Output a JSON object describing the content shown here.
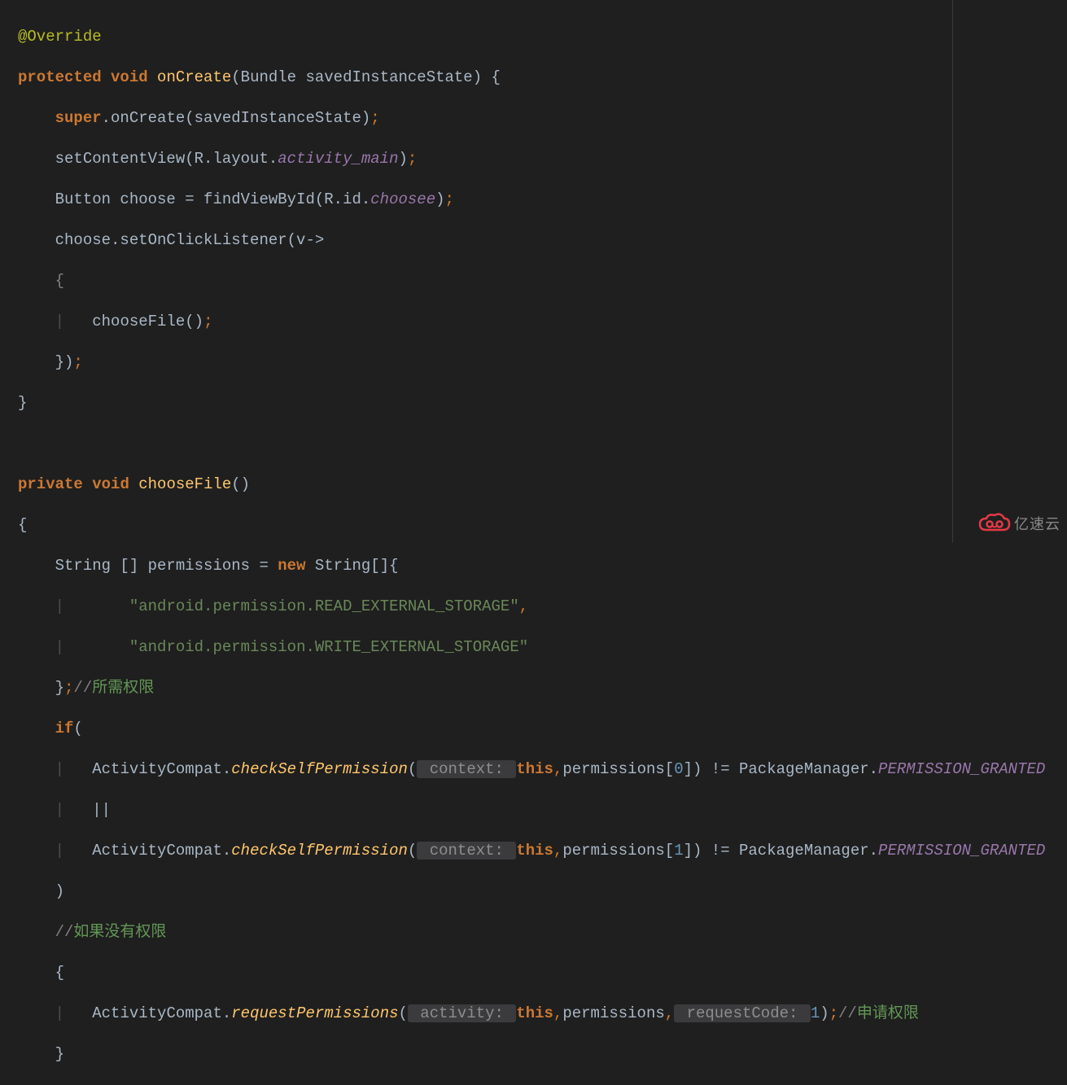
{
  "code": {
    "l1": {
      "annotation": "@Override"
    },
    "l2": {
      "kw_protected": "protected",
      "kw_void": "void",
      "method": "onCreate",
      "args": "(Bundle savedInstanceState) {"
    },
    "l3": {
      "indent": "    ",
      "kw_super": "super",
      "rest1": ".onCreate(savedInstanceState)",
      "semi": ";"
    },
    "l4": {
      "indent": "    ",
      "t1": "setContentView(R.layout.",
      "field": "activity_main",
      "t2": ")",
      "semi": ";"
    },
    "l5": {
      "indent": "    ",
      "t1": "Button choose = findViewById(R.id.",
      "field": "choosee",
      "t2": ")",
      "semi": ";"
    },
    "l6": {
      "indent": "    ",
      "t1": "choose.setOnClickListener(v->"
    },
    "l7": {
      "indent": "    ",
      "brace": "{"
    },
    "l8": {
      "indent": "    ",
      "guide": "|",
      "spc": "   ",
      "t1": "chooseFile()",
      "semi": ";"
    },
    "l9": {
      "indent": "    ",
      "t1": "})",
      "semi": ";"
    },
    "l10": {
      "brace": "}"
    },
    "l12": {
      "kw1": "private",
      "kw2": "void",
      "method": "chooseFile",
      "paren": "()"
    },
    "l13": {
      "brace": "{"
    },
    "l14": {
      "indent": "    ",
      "t1": "String [] permissions = ",
      "kw_new": "new",
      "t2": " String[]{"
    },
    "l15": {
      "indent": "    ",
      "guide": "|",
      "spc": "       ",
      "str": "\"android.permission.READ_EXTERNAL_STORAGE\"",
      "comma": ","
    },
    "l16": {
      "indent": "    ",
      "guide": "|",
      "spc": "       ",
      "str": "\"android.permission.WRITE_EXTERNAL_STORAGE\""
    },
    "l17": {
      "indent": "    ",
      "brace": "}",
      "semi": ";",
      "cm1": "//",
      "cm2": "所需权限"
    },
    "l18": {
      "indent": "    ",
      "kw_if": "if",
      "paren": "("
    },
    "l19": {
      "indent": "    ",
      "guide": "|",
      "spc": "   ",
      "t1": "ActivityCompat.",
      "static": "checkSelfPermission",
      "paren1": "(",
      "hint": " context: ",
      "kw_this": "this",
      "comma": ",",
      "t2": "permissions[",
      "num": "0",
      "t3": "]) != PackageManager.",
      "const": "PERMISSION_GRANTED"
    },
    "l20": {
      "indent": "    ",
      "guide": "|",
      "spc": "   ",
      "op": "||"
    },
    "l21": {
      "indent": "    ",
      "guide": "|",
      "spc": "   ",
      "t1": "ActivityCompat.",
      "static": "checkSelfPermission",
      "paren1": "(",
      "hint": " context: ",
      "kw_this": "this",
      "comma": ",",
      "t2": "permissions[",
      "num": "1",
      "t3": "]) != PackageManager.",
      "const": "PERMISSION_GRANTED"
    },
    "l22": {
      "indent": "    ",
      "paren": ")"
    },
    "l23": {
      "indent": "    ",
      "cm1": "//",
      "cm2": "如果没有权限"
    },
    "l24": {
      "indent": "    ",
      "brace": "{"
    },
    "l25": {
      "indent": "    ",
      "guide": "|",
      "spc": "   ",
      "t1": "ActivityCompat.",
      "static": "requestPermissions",
      "paren1": "(",
      "hint1": " activity: ",
      "kw_this": "this",
      "comma1": ",",
      "t2": "permissions",
      "comma2": ",",
      "hint2": " requestCode: ",
      "num": "1",
      "paren2": ")",
      "semi": ";",
      "cm1": "//",
      "cm2": "申请权限"
    },
    "l26": {
      "indent": "    ",
      "brace": "}"
    }
  },
  "watermark": {
    "text": "亿速云"
  },
  "colors": {
    "background": "#1f1f1f",
    "keyword": "#cc7832",
    "method": "#ffc66d",
    "string": "#6a8759",
    "number": "#6897bb",
    "field": "#9876aa",
    "comment": "#808080",
    "annotation": "#b8bb26"
  }
}
